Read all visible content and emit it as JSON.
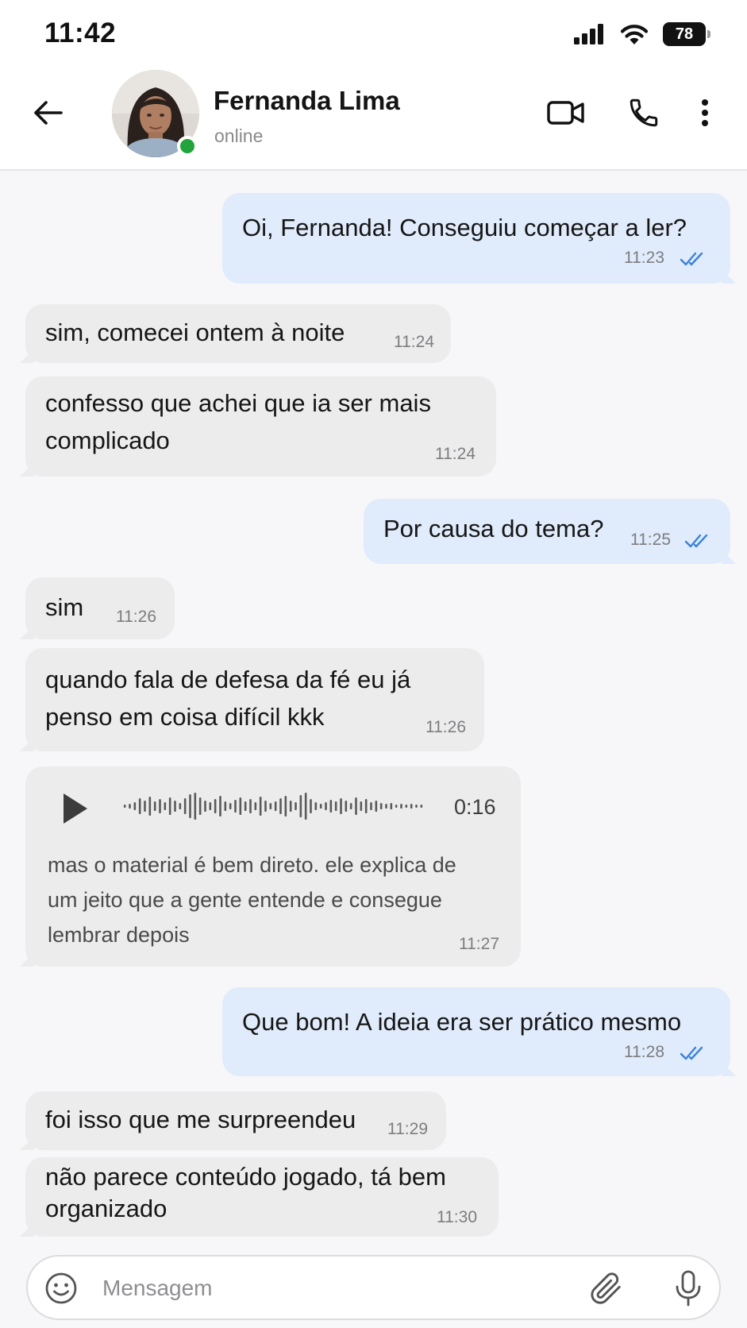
{
  "status_bar": {
    "time": "11:42",
    "battery": "78",
    "icons": [
      "cellular-signal-icon",
      "wifi-icon",
      "battery-icon"
    ]
  },
  "header": {
    "name": "Fernanda Lima",
    "status": "online",
    "icons": [
      "back-arrow-icon",
      "video-camera-icon",
      "phone-icon",
      "more-vertical-icon"
    ],
    "online_color": "#22a33b"
  },
  "messages": [
    {
      "dir": "out",
      "text": "Oi, Fernanda! Conseguiu começar a ler?",
      "time": "11:23",
      "read": true
    },
    {
      "dir": "in",
      "text": "sim, comecei ontem à noite",
      "time": "11:24"
    },
    {
      "dir": "in",
      "lines": [
        "confesso que achei que ia ser mais",
        "complicado"
      ],
      "time": "11:24"
    },
    {
      "dir": "out",
      "text": "Por causa do tema?",
      "time": "11:25",
      "read": true
    },
    {
      "dir": "in",
      "text": "sim",
      "time": "11:26"
    },
    {
      "dir": "in",
      "lines": [
        "quando fala de defesa da fé eu já",
        "penso em coisa difícil kkk"
      ],
      "time": "11:26"
    },
    {
      "dir": "in",
      "type": "voice",
      "duration": "0:16",
      "transcript_lines": [
        "mas o material é bem direto. ele explica de",
        "um jeito que a gente entende e consegue",
        "lembrar depois"
      ],
      "time": "11:27"
    },
    {
      "dir": "out",
      "text": "Que bom! A ideia era ser prático mesmo",
      "time": "11:28",
      "read": true
    },
    {
      "dir": "in",
      "text": "foi isso que me surpreendeu",
      "time": "11:29"
    },
    {
      "dir": "in",
      "lines": [
        "não parece conteúdo jogado, tá bem",
        "organizado"
      ],
      "time": "11:30"
    }
  ],
  "composer": {
    "placeholder": "Mensagem",
    "icons": [
      "emoji-icon",
      "paperclip-icon",
      "microphone-icon"
    ]
  },
  "colors": {
    "incoming_bubble": "#ececed",
    "outgoing_bubble": "#e0ebfb",
    "read_ticks": "#3b82d6",
    "background": "#f7f7f9"
  }
}
